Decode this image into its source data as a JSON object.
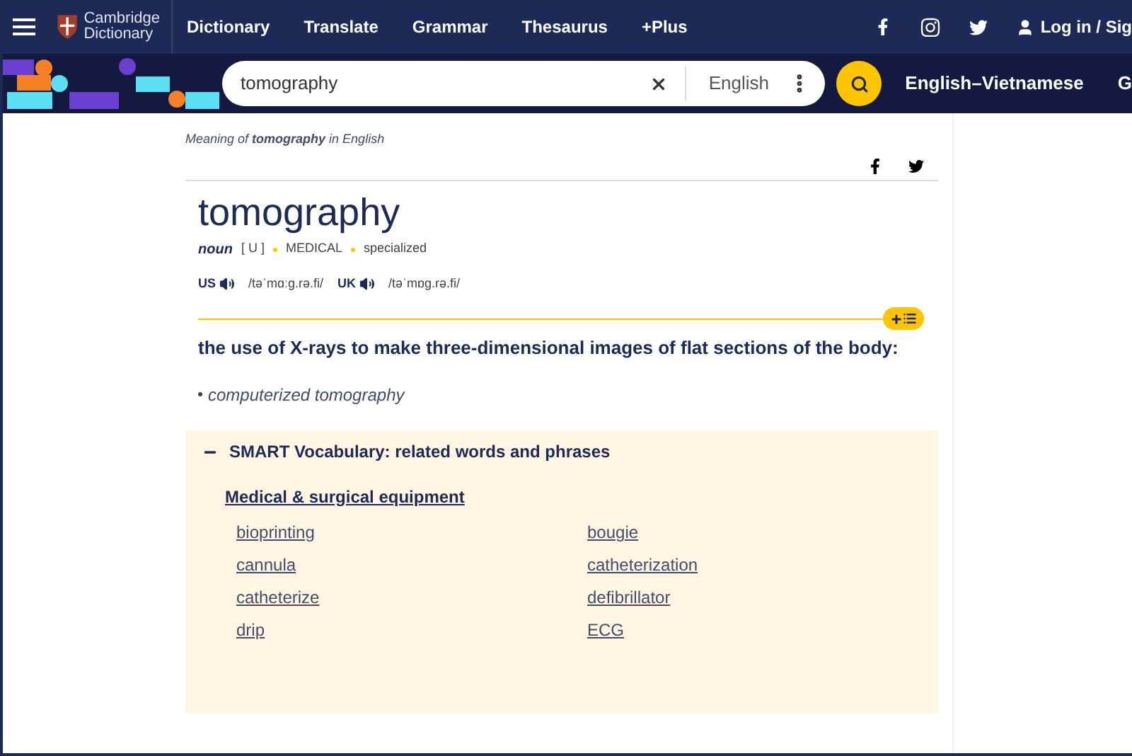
{
  "header": {
    "logo": [
      "Cambridge",
      "Dictionary"
    ],
    "nav": [
      "Dictionary",
      "Translate",
      "Grammar",
      "Thesaurus",
      "+Plus"
    ],
    "login": "Log in / Sig"
  },
  "search": {
    "value": "tomography",
    "language": "English",
    "dictionary": "English–Vietnamese",
    "cut_link": "G"
  },
  "entry": {
    "meaning": "Meaning of **tomography** in English",
    "headword": "tomography",
    "pos": "noun",
    "grammar": "[ U ]",
    "labels": [
      "MEDICAL",
      "specialized"
    ],
    "pron": [
      {
        "region": "US",
        "ipa": "/təˈmɑːg.rə.fi/"
      },
      {
        "region": "UK",
        "ipa": "/təˈmɒg.rə.fi/"
      }
    ],
    "definition": "the use of X-rays to make three-dimensional images of flat sections of the body:",
    "examples": [
      "computerized tomography"
    ]
  },
  "smart_vocab": {
    "title": "SMART Vocabulary: related words and phrases",
    "expanded": true,
    "topic": "Medical & surgical equipment",
    "words": [
      "bioprinting",
      "bougie",
      "cannula",
      "catheterization",
      "catheterize",
      "defibrillator",
      "drip",
      "ECG"
    ]
  }
}
